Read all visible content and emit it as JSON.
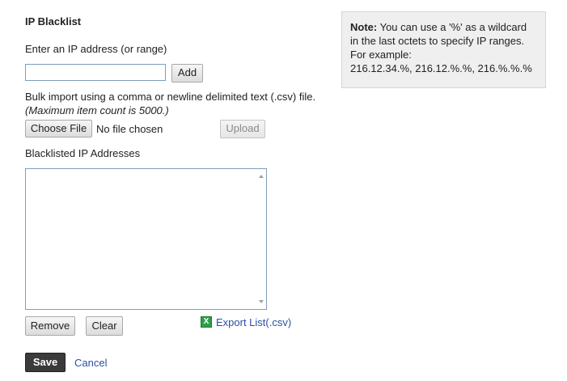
{
  "title": "IP Blacklist",
  "ip_input": {
    "label": "Enter an IP address (or range)",
    "value": "",
    "add_label": "Add"
  },
  "bulk_import": {
    "description": "Bulk import using a comma or newline delimited text (.csv) file.",
    "limit_note": "(Maximum item count is 5000.)",
    "choose_file_label": "Choose File",
    "file_status": "No file chosen",
    "upload_label": "Upload"
  },
  "blacklist": {
    "label": "Blacklisted IP Addresses",
    "items": [],
    "remove_label": "Remove",
    "clear_label": "Clear",
    "export_label": "Export List(.csv)",
    "export_icon": "excel-icon"
  },
  "note": {
    "heading": "Note:",
    "line1": " You can use a '%' as a wildcard",
    "line2": "in the last octets to specify IP ranges.",
    "line3": "For example:",
    "line4": "216.12.34.%, 216.12.%.%, 216.%.%.%"
  },
  "footer": {
    "save_label": "Save",
    "cancel_label": "Cancel"
  },
  "colors": {
    "link": "#2a4fa0",
    "save_bg": "#3a3a3a",
    "note_bg": "#efefef"
  }
}
